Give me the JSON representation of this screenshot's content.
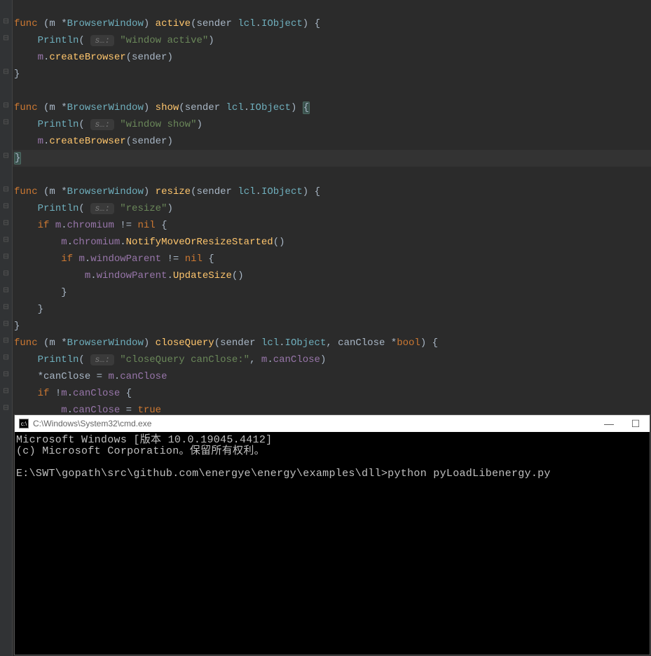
{
  "code": {
    "func_kw": "func",
    "receiver": "m",
    "recv_type": "BrowserWindow",
    "sender": "sender",
    "lcl": "lcl",
    "iobject": "IObject",
    "println": "Println",
    "hint": "s…:",
    "createBrowser": "createBrowser",
    "active_fn": "active",
    "active_str": "\"window active\"",
    "show_fn": "show",
    "show_str": "\"window show\"",
    "resize_fn": "resize",
    "resize_str": "\"resize\"",
    "if_kw": "if",
    "chromium": "chromium",
    "nil": "nil",
    "notifyMove": "NotifyMoveOrResizeStarted",
    "windowParent": "windowParent",
    "updateSize": "UpdateSize",
    "closeQuery_fn": "closeQuery",
    "canClose_param": "canClose",
    "bool": "bool",
    "closeQuery_str": "\"closeQuery canClose:\"",
    "canClose": "canClose",
    "true": "true",
    "not": "!",
    "star": "*",
    "assign": "="
  },
  "cmd": {
    "title": "C:\\Windows\\System32\\cmd.exe",
    "line1": "Microsoft Windows [版本 10.0.19045.4412]",
    "line2": "(c) Microsoft Corporation。保留所有权利。",
    "prompt": "E:\\SWT\\gopath\\src\\github.com\\energye\\energy\\examples\\dll>python pyLoadLibenergy.py"
  }
}
